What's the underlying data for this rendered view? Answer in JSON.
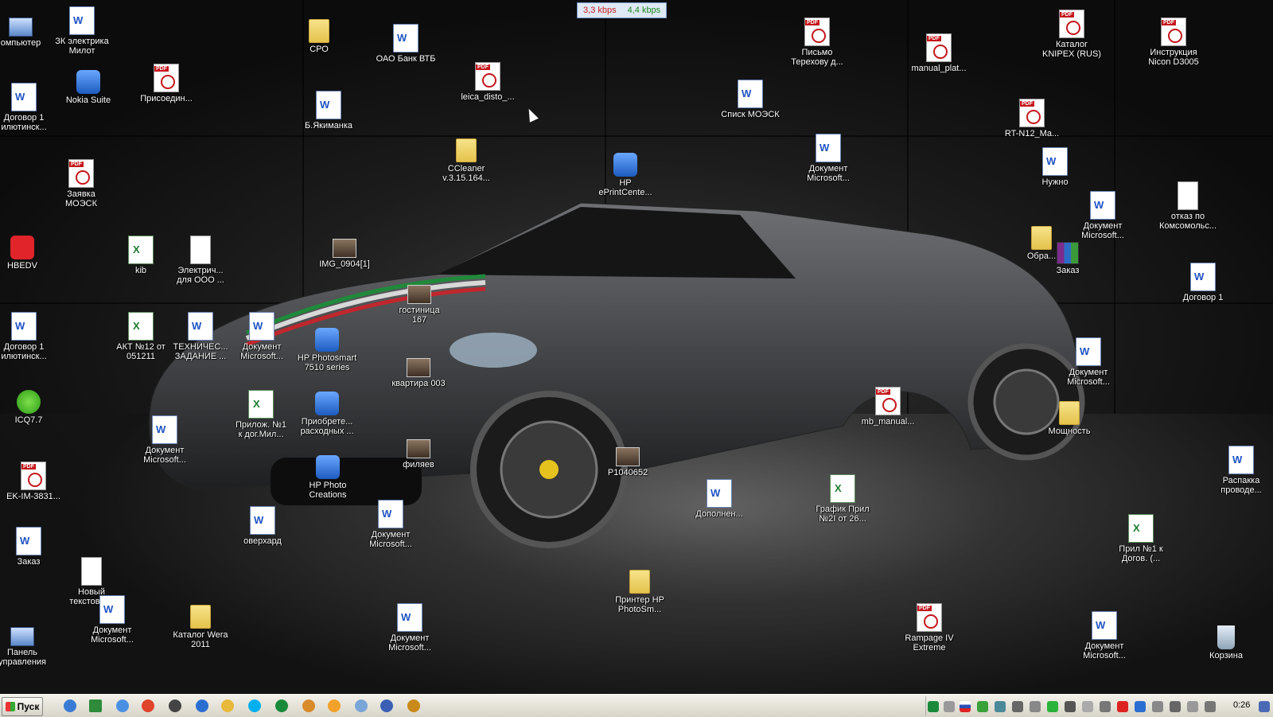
{
  "netmeter": {
    "download": "3,3 kbps",
    "upload": "4,4 kbps"
  },
  "desktop_icons": [
    {
      "label": "омпьютер",
      "type": "computer"
    },
    {
      "label": "ЗК электрика\nМилот",
      "type": "word"
    },
    {
      "label": "СРО",
      "type": "folder"
    },
    {
      "label": "ОАО Банк ВТБ",
      "type": "word"
    },
    {
      "label": "Письмо\nТерехову д...",
      "type": "pdf"
    },
    {
      "label": "manual_plat...",
      "type": "pdf"
    },
    {
      "label": "Каталог\nKNIPEX (RUS)",
      "type": "pdf"
    },
    {
      "label": "Инструкция\nNicon D3005",
      "type": "pdf"
    },
    {
      "label": "Nokia Suite",
      "type": "app"
    },
    {
      "label": "Присоедин...",
      "type": "pdf"
    },
    {
      "label": "leica_disto_...",
      "type": "pdf"
    },
    {
      "label": "Договор 1\nилютинск...",
      "type": "word"
    },
    {
      "label": "Б.Якиманка",
      "type": "word"
    },
    {
      "label": "Списк МОЭСК",
      "type": "word"
    },
    {
      "label": "RT-N12_Ma...",
      "type": "pdf"
    },
    {
      "label": "CCleaner\nv.3.15.164...",
      "type": "folder"
    },
    {
      "label": "Документ\nMicrosoft...",
      "type": "word"
    },
    {
      "label": "HP\nePrintCente...",
      "type": "app"
    },
    {
      "label": "Нужно",
      "type": "word"
    },
    {
      "label": "Заявка\nМОЭСК",
      "type": "pdf"
    },
    {
      "label": "отказ по\nКомсомольс...",
      "type": "txt"
    },
    {
      "label": "Документ\nMicrosoft...",
      "type": "word"
    },
    {
      "label": "HBEDV",
      "type": "red"
    },
    {
      "label": "kib",
      "type": "excel"
    },
    {
      "label": "Электрич...\nдля ООО ...",
      "type": "txt"
    },
    {
      "label": "IMG_0904[1]",
      "type": "photo"
    },
    {
      "label": "Обра...",
      "type": "folder"
    },
    {
      "label": "Заказ",
      "type": "winrar"
    },
    {
      "label": "гостиница\n167",
      "type": "photo"
    },
    {
      "label": "Договор 1",
      "type": "word"
    },
    {
      "label": "Договор 1\nилютинск...",
      "type": "word"
    },
    {
      "label": "АКТ №12 от\n051211",
      "type": "excel"
    },
    {
      "label": "ТЕХНИЧЕС...\nЗАДАНИЕ ...",
      "type": "word"
    },
    {
      "label": "Документ\nMicrosoft...",
      "type": "word"
    },
    {
      "label": "HP Photosmart\n7510 series",
      "type": "app"
    },
    {
      "label": "квартира 003",
      "type": "photo"
    },
    {
      "label": "Документ\nMicrosoft...",
      "type": "word"
    },
    {
      "label": "ICQ7.7",
      "type": "green"
    },
    {
      "label": "Прилож. №1\nк дог.Мил...",
      "type": "excel"
    },
    {
      "label": "Приобрете...\nрасходных ...",
      "type": "app"
    },
    {
      "label": "mb_manual...",
      "type": "pdf"
    },
    {
      "label": "Мощность",
      "type": "folder"
    },
    {
      "label": "Документ\nMicrosoft...",
      "type": "word"
    },
    {
      "label": "филяев",
      "type": "photo"
    },
    {
      "label": "EK-IM-3831...",
      "type": "pdf"
    },
    {
      "label": "HP Photo\nCreations",
      "type": "app"
    },
    {
      "label": "P1040652",
      "type": "photo"
    },
    {
      "label": "Распакка\nпроводе...",
      "type": "word"
    },
    {
      "label": "Дополнен...",
      "type": "word"
    },
    {
      "label": "График Прил\n№2I от 26...",
      "type": "excel"
    },
    {
      "label": "оверхард",
      "type": "word"
    },
    {
      "label": "Документ\nMicrosoft...",
      "type": "word"
    },
    {
      "label": "Прил №1 к\nДогов. (...",
      "type": "excel"
    },
    {
      "label": "Заказ",
      "type": "word"
    },
    {
      "label": "Новый\nтекстовы...",
      "type": "txt"
    },
    {
      "label": "Документ\nMicrosoft...",
      "type": "word"
    },
    {
      "label": "Принтер HP\nPhotoSm...",
      "type": "folder"
    },
    {
      "label": "Rampage IV\nExtreme",
      "type": "pdf"
    },
    {
      "label": "Документ\nMicrosoft...",
      "type": "word"
    },
    {
      "label": "Панель\nуправления",
      "type": "computer"
    },
    {
      "label": "Каталог Wera\n2011",
      "type": "folder"
    },
    {
      "label": "Документ\nMicrosoft...",
      "type": "word"
    },
    {
      "label": "Корзина",
      "type": "trash"
    }
  ],
  "taskbar": {
    "start_label": "Пуск",
    "clock": "0:26"
  }
}
